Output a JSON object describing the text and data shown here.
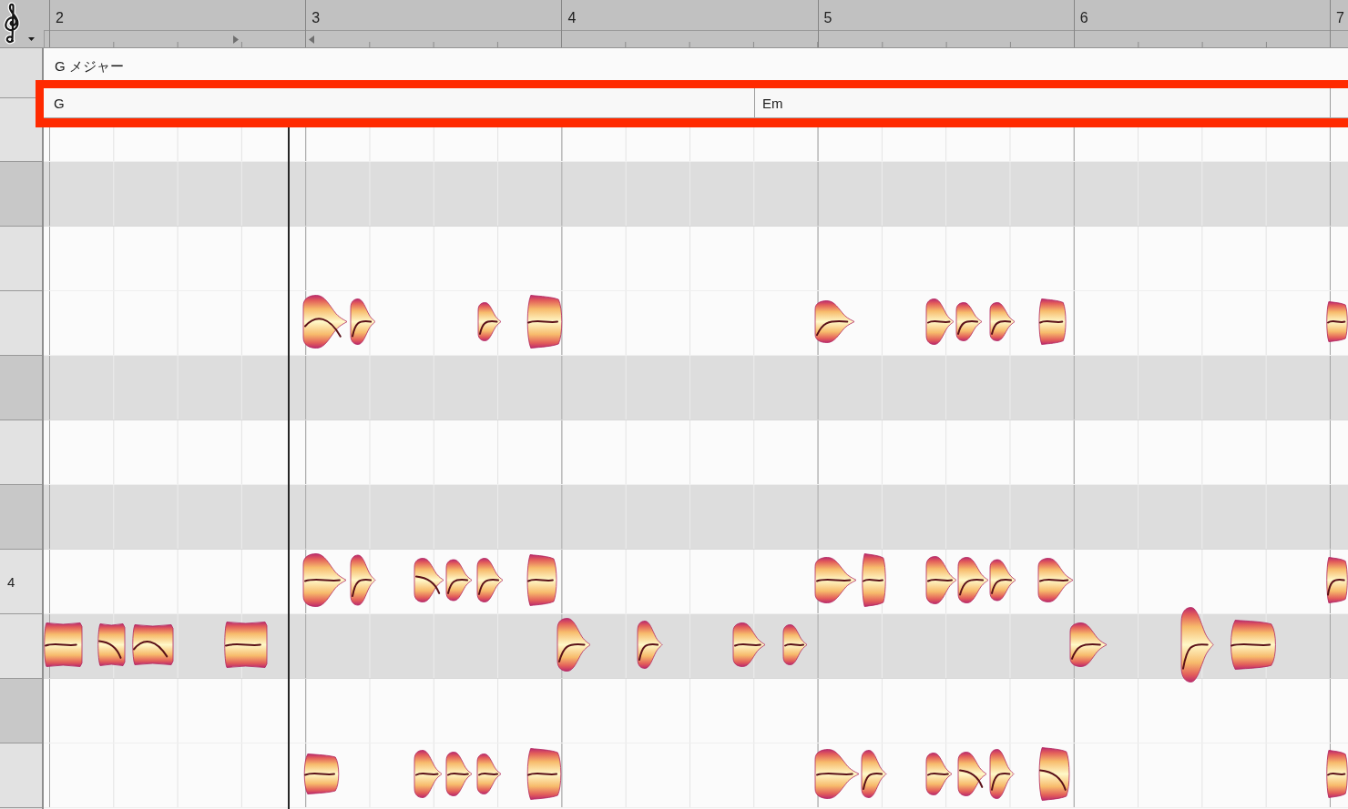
{
  "ruler": {
    "bars": [
      "2",
      "3",
      "4",
      "5",
      "6",
      "7"
    ]
  },
  "key_track": {
    "label": "G メジャー"
  },
  "chord_track": {
    "highlighted": true,
    "chords": [
      {
        "label": "G"
      },
      {
        "label": "Em"
      }
    ]
  },
  "pitch_rows": [
    {
      "kind": "white",
      "shaded": false
    },
    {
      "kind": "black",
      "shaded": true
    },
    {
      "kind": "white",
      "shaded": false
    },
    {
      "kind": "white",
      "shaded": false
    },
    {
      "kind": "black",
      "shaded": true
    },
    {
      "kind": "white",
      "shaded": false
    },
    {
      "kind": "black",
      "shaded": true
    },
    {
      "kind": "white",
      "shaded": false,
      "label": "4"
    },
    {
      "kind": "white",
      "shaded": true
    },
    {
      "kind": "black",
      "shaded": false
    },
    {
      "kind": "white",
      "shaded": false
    }
  ]
}
